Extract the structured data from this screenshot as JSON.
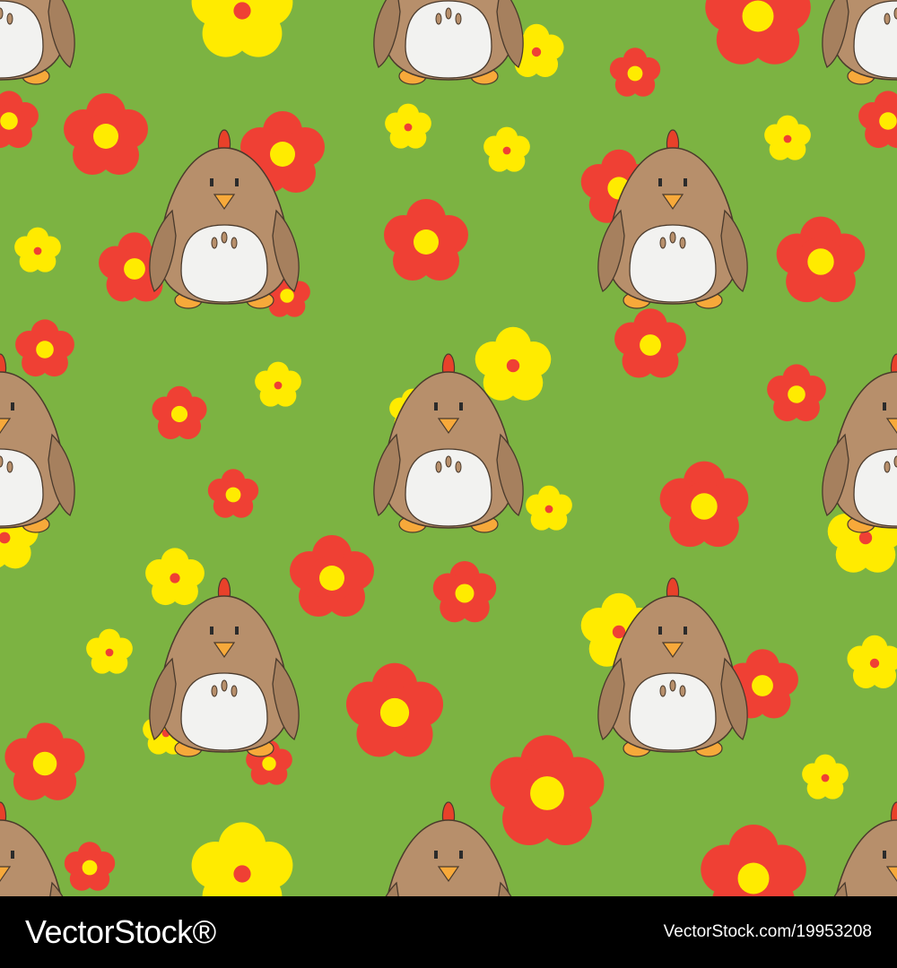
{
  "pattern": {
    "background_color": "#7cb342",
    "motif": "cartoon-chicken-and-flowers",
    "colors": {
      "red_flower": "#ef4034",
      "yellow_flower": "#ffeb00",
      "chicken_body": "#b78f6b",
      "chicken_wing": "#a6805e",
      "chicken_belly": "#f2f2f0",
      "beak_feet": "#f7a93a",
      "comb": "#e8412a",
      "outline": "#4a3a2c"
    }
  },
  "footer": {
    "brand": "VectorStock®",
    "image_ref": "VectorStock.com/19953208"
  }
}
